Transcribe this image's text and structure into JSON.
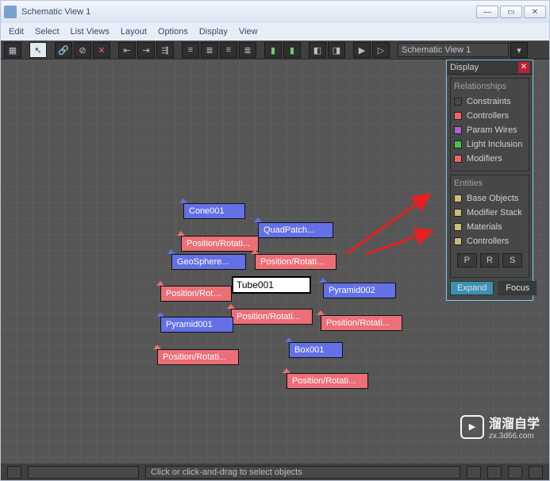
{
  "window": {
    "title": "Schematic View 1"
  },
  "menus": [
    "Edit",
    "Select",
    "List Views",
    "Layout",
    "Options",
    "Display",
    "View"
  ],
  "toolbar_combo": "Schematic View 1",
  "status": {
    "text": "Click or click-and-drag to select objects"
  },
  "display_panel": {
    "title": "Display",
    "groups": [
      {
        "label": "Relationships",
        "items": [
          {
            "color": "#e66",
            "label": "Constraints"
          },
          {
            "color": "#e66",
            "label": "Controllers"
          },
          {
            "color": "#b060d0",
            "label": "Param Wires"
          },
          {
            "color": "#4ac24a",
            "label": "Light Inclusion"
          },
          {
            "color": "#e66",
            "label": "Modifiers"
          }
        ]
      },
      {
        "label": "Entities",
        "items": [
          {
            "color": "#cabd7a",
            "label": "Base Objects"
          },
          {
            "color": "#cabd7a",
            "label": "Modifier Stack"
          },
          {
            "color": "#cabd7a",
            "label": "Materials"
          },
          {
            "color": "#cabd7a",
            "label": "Controllers"
          }
        ]
      }
    ],
    "prs": [
      "P",
      "R",
      "S"
    ],
    "expand": "Expand",
    "focus": "Focus"
  },
  "nodes": {
    "cone": "Cone001",
    "quadpatch": "QuadPatch...",
    "geo": "GeoSphere...",
    "tube": "Tube001",
    "pyr2": "Pyramid002",
    "pyr1": "Pyramid001",
    "box": "Box001",
    "posrot": "Position/Rotati..."
  },
  "watermark": {
    "brand": "溜溜自学",
    "url": "zx.3d66.com"
  }
}
